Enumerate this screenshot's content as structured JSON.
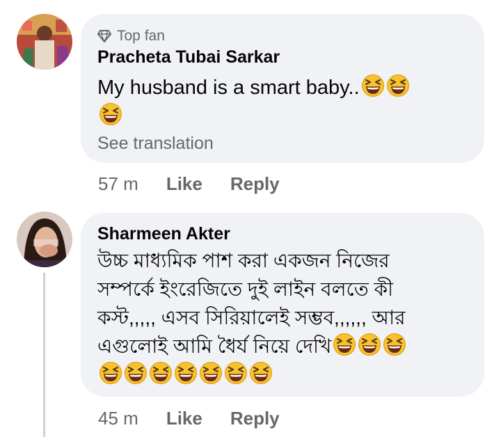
{
  "comments": [
    {
      "badge": "Top fan",
      "author": "Pracheta Tubai Sarkar",
      "text": "My husband is a smart baby..",
      "emoji_line1": 2,
      "emoji_line2": 1,
      "see_translation": "See translation",
      "time": "57 m",
      "like": "Like",
      "reply": "Reply"
    },
    {
      "author": "Sharmeen Akter",
      "lines": [
        "উচ্চ মাধ্যমিক পাশ করা একজন নিজের",
        "সম্পর্কে ইংরেজিতে দুই লাইন বলতে কী",
        "কস্ট,,,,, এসব সিরিয়ালেই সম্ভব,,,,,, আর",
        "এগুলোই আমি ধৈর্য নিয়ে দেখি"
      ],
      "emoji_line4": 3,
      "emoji_line5": 7,
      "time": "45 m",
      "like": "Like",
      "reply": "Reply"
    }
  ],
  "icons": {
    "badge": "diamond-icon",
    "emoji": "laughing-squinting-face-emoji"
  },
  "colors": {
    "bubble": "#f0f2f5",
    "secondary_text": "#65676b",
    "emoji_face": "#f7c22f"
  }
}
